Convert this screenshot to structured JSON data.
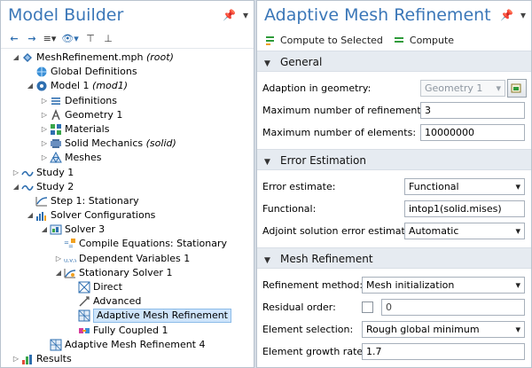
{
  "model_builder": {
    "title": "Model Builder",
    "tree": [
      {
        "label": "MeshRefinement.mph",
        "suffix": " (root)",
        "icon": "model-root-icon",
        "level": 0,
        "expander": "open"
      },
      {
        "label": "Global Definitions",
        "suffix": "",
        "icon": "global-definitions-icon",
        "level": 1,
        "expander": "none"
      },
      {
        "label": "Model 1",
        "suffix": " (mod1)",
        "icon": "model-icon",
        "level": 1,
        "expander": "open"
      },
      {
        "label": "Definitions",
        "suffix": "",
        "icon": "definitions-icon",
        "level": 2,
        "expander": "closed"
      },
      {
        "label": "Geometry 1",
        "suffix": "",
        "icon": "geometry-icon",
        "level": 2,
        "expander": "closed"
      },
      {
        "label": "Materials",
        "suffix": "",
        "icon": "materials-icon",
        "level": 2,
        "expander": "closed"
      },
      {
        "label": "Solid Mechanics",
        "suffix": " (solid)",
        "icon": "solid-mechanics-icon",
        "level": 2,
        "expander": "closed"
      },
      {
        "label": "Meshes",
        "suffix": "",
        "icon": "mesh-icon",
        "level": 2,
        "expander": "closed"
      },
      {
        "label": "Study 1",
        "suffix": "",
        "icon": "study-icon",
        "level": 0,
        "expander": "closed"
      },
      {
        "label": "Study 2",
        "suffix": "",
        "icon": "study-icon",
        "level": 0,
        "expander": "open"
      },
      {
        "label": "Step 1: Stationary",
        "suffix": "",
        "icon": "stationary-step-icon",
        "level": 1,
        "expander": "none"
      },
      {
        "label": "Solver Configurations",
        "suffix": "",
        "icon": "solver-configurations-icon",
        "level": 1,
        "expander": "open"
      },
      {
        "label": "Solver 3",
        "suffix": "",
        "icon": "solver-icon",
        "level": 2,
        "expander": "open"
      },
      {
        "label": "Compile Equations: Stationary",
        "suffix": "",
        "icon": "compile-equations-icon",
        "level": 3,
        "expander": "none"
      },
      {
        "label": "Dependent Variables 1",
        "suffix": "",
        "icon": "dependent-variables-icon",
        "level": 3,
        "expander": "closed"
      },
      {
        "label": "Stationary Solver 1",
        "suffix": "",
        "icon": "stationary-solver-icon",
        "level": 3,
        "expander": "open"
      },
      {
        "label": "Direct",
        "suffix": "",
        "icon": "direct-solver-icon",
        "level": 4,
        "expander": "none"
      },
      {
        "label": "Advanced",
        "suffix": "",
        "icon": "advanced-icon",
        "level": 4,
        "expander": "none"
      },
      {
        "label": "Adaptive Mesh Refinement",
        "suffix": "",
        "icon": "adaptive-mesh-icon",
        "level": 4,
        "expander": "none",
        "selected": true
      },
      {
        "label": "Fully Coupled 1",
        "suffix": "",
        "icon": "fully-coupled-icon",
        "level": 4,
        "expander": "none"
      },
      {
        "label": "Adaptive Mesh Refinement 4",
        "suffix": "",
        "icon": "adaptive-mesh-icon",
        "level": 2,
        "expander": "none"
      },
      {
        "label": "Results",
        "suffix": "",
        "icon": "results-icon",
        "level": 0,
        "expander": "closed"
      }
    ]
  },
  "settings": {
    "title": "Adaptive Mesh Refinement",
    "toolbar": {
      "compute_selected": "Compute to Selected",
      "compute": "Compute"
    },
    "general": {
      "header": "General",
      "adaption_label": "Adaption in geometry:",
      "adaption_value": "Geometry 1",
      "max_refinements_label": "Maximum number of refinements:",
      "max_refinements_value": "3",
      "max_elements_label": "Maximum number of elements:",
      "max_elements_value": "10000000"
    },
    "error_estimation": {
      "header": "Error Estimation",
      "estimate_label": "Error estimate:",
      "estimate_value": "Functional",
      "functional_label": "Functional:",
      "functional_value": "intop1(solid.mises)",
      "adjoint_label": "Adjoint solution error estimate:",
      "adjoint_value": "Automatic"
    },
    "mesh_refinement": {
      "header": "Mesh Refinement",
      "method_label": "Refinement method:",
      "method_value": "Mesh initialization",
      "residual_label": "Residual order:",
      "residual_value": "0",
      "element_selection_label": "Element selection:",
      "element_selection_value": "Rough global minimum",
      "growth_label": "Element growth rate:",
      "growth_value": "1.7"
    }
  },
  "colors": {
    "title_blue": "#3b77b8",
    "selection": "#cfe5fb",
    "compute_green": "#2e9b3a"
  }
}
